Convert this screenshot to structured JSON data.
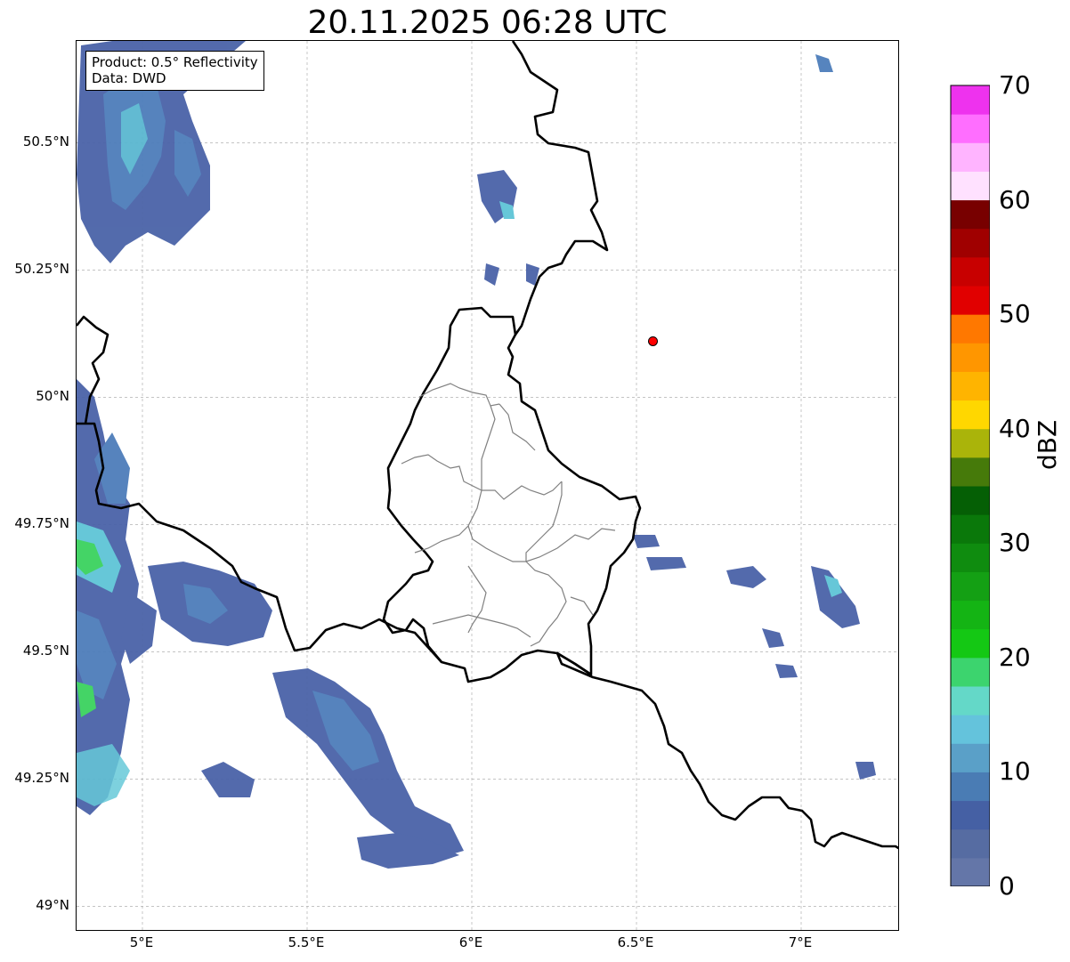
{
  "title": "20.11.2025 06:28 UTC",
  "info": {
    "product": "Product: 0.5° Reflectivity",
    "source": "Data: DWD"
  },
  "map_extent": {
    "lon_min": 4.8,
    "lon_max": 7.3,
    "lat_min": 48.95,
    "lat_max": 50.7
  },
  "lat_ticks": [
    {
      "value": 50.5,
      "label": "50.5°N"
    },
    {
      "value": 50.25,
      "label": "50.25°N"
    },
    {
      "value": 50.0,
      "label": "50°N"
    },
    {
      "value": 49.75,
      "label": "49.75°N"
    },
    {
      "value": 49.5,
      "label": "49.5°N"
    },
    {
      "value": 49.25,
      "label": "49.25°N"
    },
    {
      "value": 49.0,
      "label": "49°N"
    }
  ],
  "lon_ticks": [
    {
      "value": 5.0,
      "label": "5°E"
    },
    {
      "value": 5.5,
      "label": "5.5°E"
    },
    {
      "value": 6.0,
      "label": "6°E"
    },
    {
      "value": 6.5,
      "label": "6.5°E"
    },
    {
      "value": 7.0,
      "label": "7°E"
    }
  ],
  "marker": {
    "lon": 6.55,
    "lat": 50.11,
    "color": "#ff0000"
  },
  "colorbar": {
    "label": "dBZ",
    "min": 0,
    "max": 70,
    "ticks": [
      "0",
      "10",
      "20",
      "30",
      "40",
      "50",
      "60",
      "70"
    ],
    "colors": [
      "#6476a8",
      "#566ca2",
      "#4560a4",
      "#4a7cb4",
      "#5aa0c8",
      "#64c3dc",
      "#64d8c8",
      "#3cd46e",
      "#14c814",
      "#14b414",
      "#14a014",
      "#0f8c0f",
      "#0a780a",
      "#055f05",
      "#467a0a",
      "#aab40a",
      "#ffd700",
      "#ffb400",
      "#ff9600",
      "#ff7800",
      "#e10000",
      "#c80000",
      "#a00000",
      "#780000",
      "#ffe1ff",
      "#ffb4ff",
      "#ff6eff",
      "#ee32ee"
    ]
  },
  "echo_colors": {
    "light": "#4a63a8",
    "medium": "#4d7dba",
    "cyan": "#5ec5d6",
    "green": "#3ad25e"
  }
}
